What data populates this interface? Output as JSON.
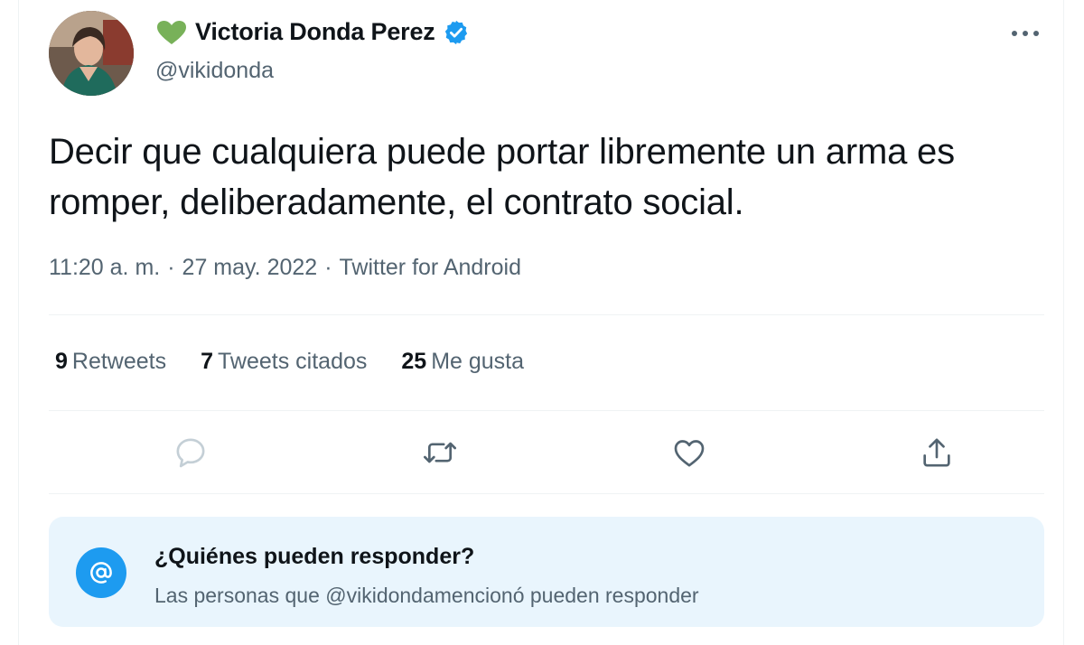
{
  "author": {
    "emoji_icon": "green-heart-icon",
    "display_name": "Victoria Donda Perez",
    "handle": "@vikidonda",
    "verified_icon": "verified-badge-icon"
  },
  "tweet": {
    "text": "Decir que cualquiera puede portar libremente un arma es romper, deliberadamente, el contrato social.",
    "time": "11:20 a. m.",
    "separator": "·",
    "date": "27 may. 2022",
    "source": "Twitter for Android"
  },
  "stats": {
    "retweets_count": "9",
    "retweets_label": "Retweets",
    "quotes_count": "7",
    "quotes_label": "Tweets citados",
    "likes_count": "25",
    "likes_label": "Me gusta"
  },
  "actions": {
    "reply_icon": "reply-icon",
    "retweet_icon": "retweet-icon",
    "like_icon": "heart-icon",
    "share_icon": "share-icon"
  },
  "reply_notice": {
    "icon": "at-sign-icon",
    "title": "¿Quiénes pueden responder?",
    "body": "Las personas que @vikidondamencionó pueden responder"
  },
  "colors": {
    "accent": "#1d9bf0",
    "text_primary": "#0f1419",
    "text_secondary": "#536471",
    "heart_green": "#78b159",
    "notice_bg": "#e9f5fd"
  }
}
